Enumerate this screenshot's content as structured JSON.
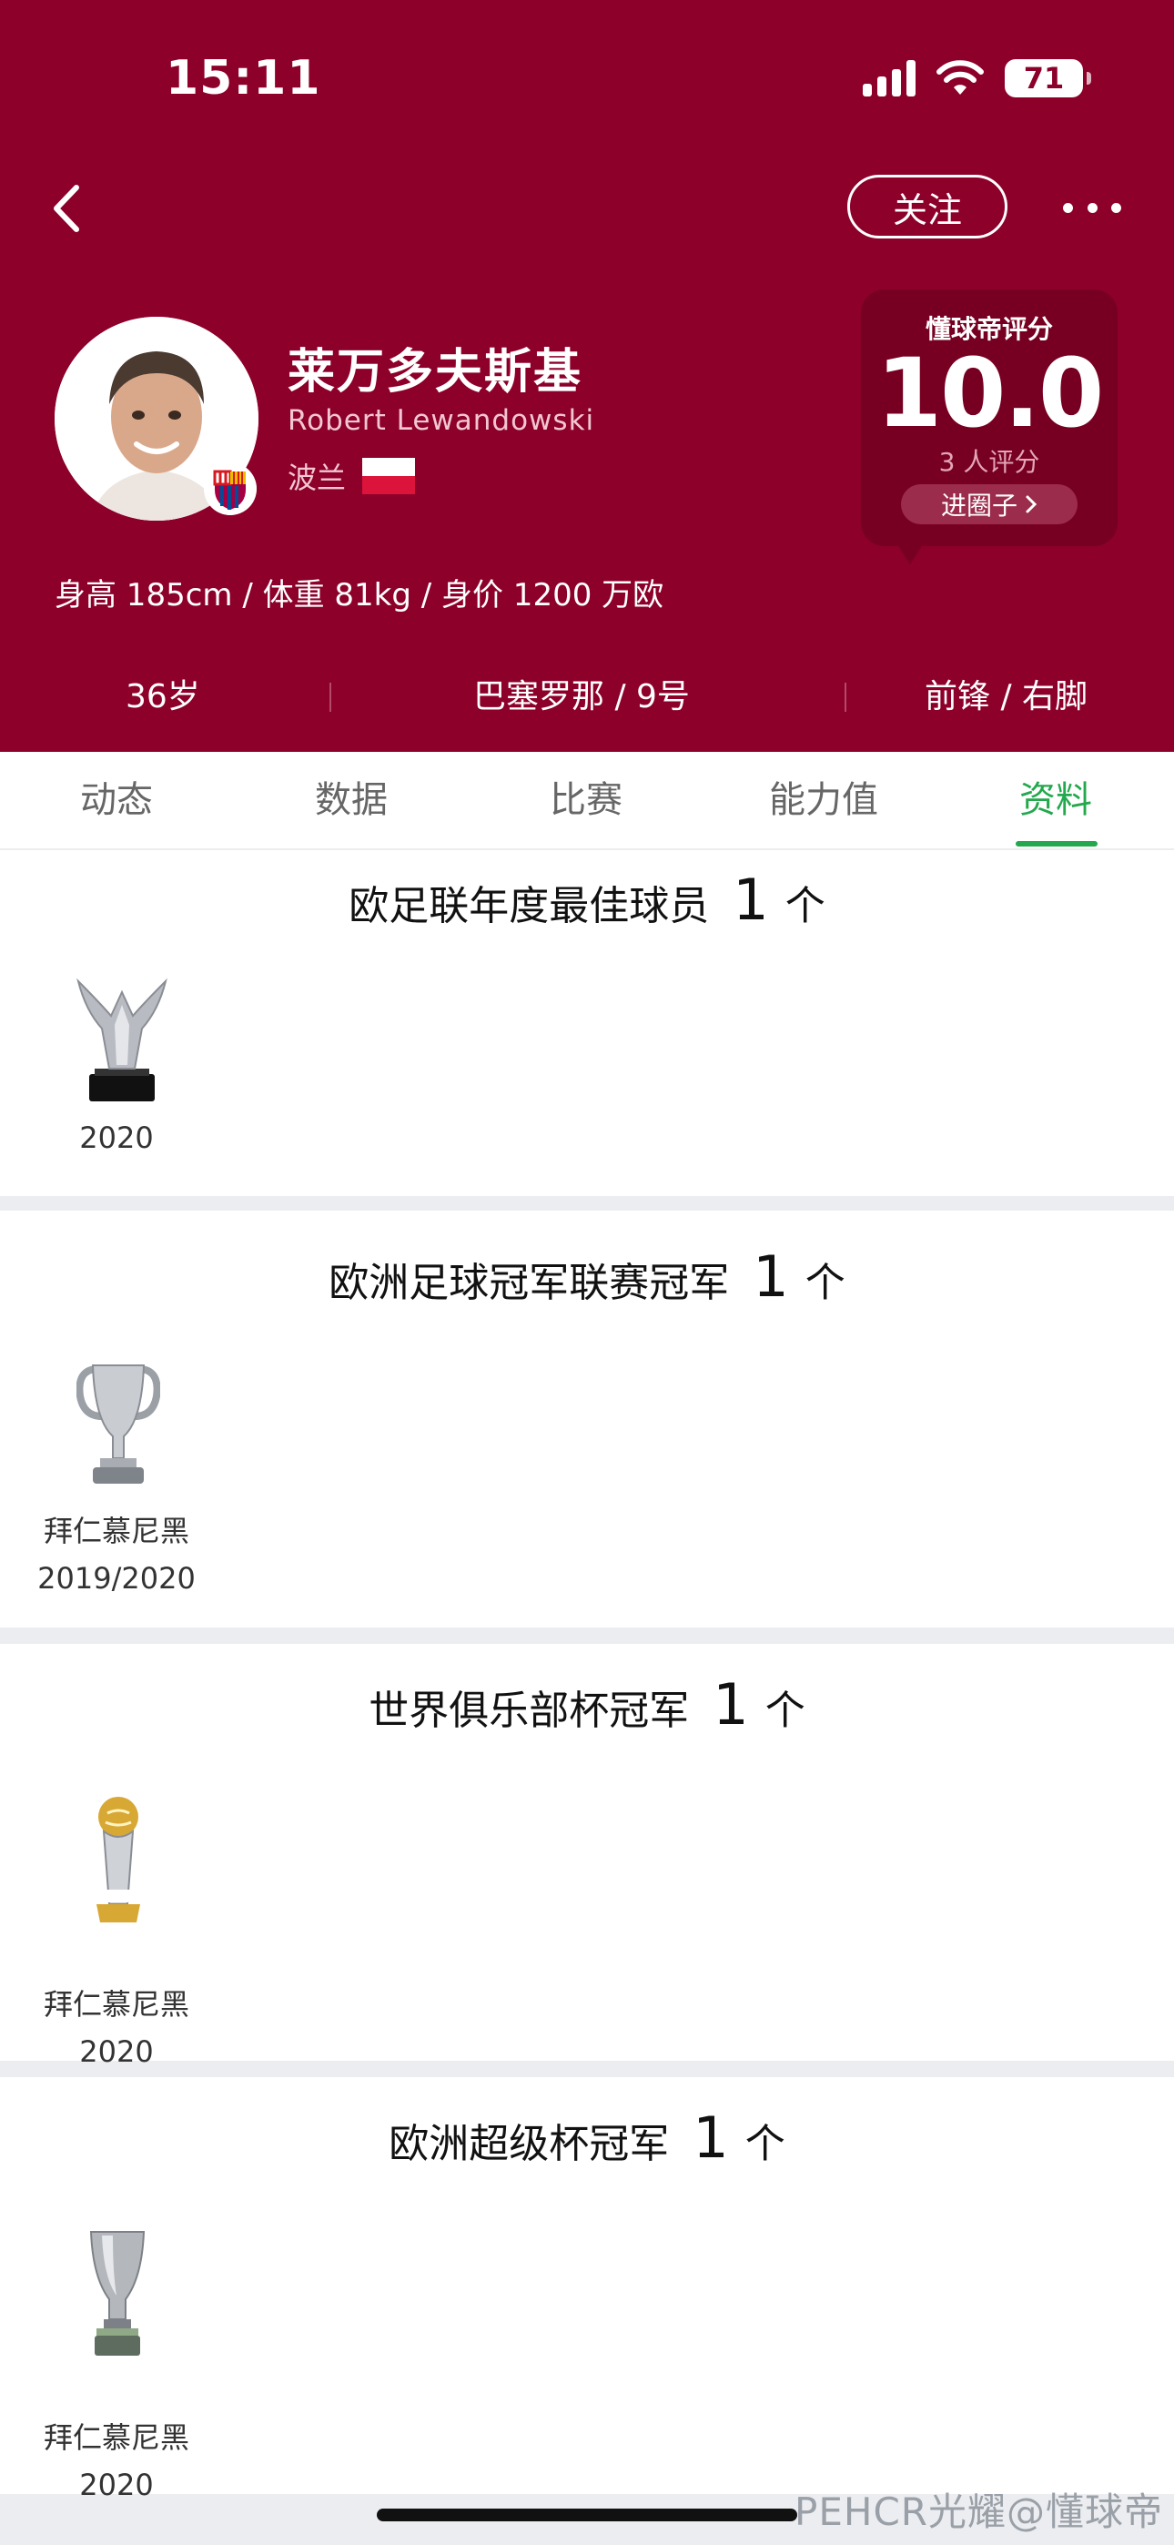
{
  "status_bar": {
    "time": "15:11",
    "battery": "71"
  },
  "header": {
    "follow_label": "关注",
    "player": {
      "name_cn": "莱万多夫斯基",
      "name_en": "Robert Lewandowski",
      "nationality": "波兰",
      "body_info": "身高 185cm / 体重 81kg / 身价 1200 万欧"
    },
    "rating": {
      "title": "懂球帝评分",
      "value": "10.0",
      "count": "3 人评分",
      "circle_button": "进圈子"
    },
    "meta": [
      {
        "text": "36岁"
      },
      {
        "text": "巴塞罗那 / 9号"
      },
      {
        "text": "前锋 / 右脚"
      }
    ]
  },
  "tabs": [
    {
      "label": "动态"
    },
    {
      "label": "数据"
    },
    {
      "label": "比赛"
    },
    {
      "label": "能力值"
    },
    {
      "label": "资料",
      "active": true
    }
  ],
  "honours": [
    {
      "title": "欧足联年度最佳球员",
      "count": "1",
      "unit": "个",
      "trophies": [
        {
          "icon": "uefa-player-award-icon",
          "team": "",
          "season": "2020"
        }
      ]
    },
    {
      "title": "欧洲足球冠军联赛冠军",
      "count": "1",
      "unit": "个",
      "trophies": [
        {
          "icon": "champions-league-trophy-icon",
          "team": "拜仁慕尼黑",
          "season": "2019/2020"
        }
      ]
    },
    {
      "title": "世界俱乐部杯冠军",
      "count": "1",
      "unit": "个",
      "trophies": [
        {
          "icon": "club-world-cup-trophy-icon",
          "team": "拜仁慕尼黑",
          "season": "2020"
        }
      ]
    },
    {
      "title": "欧洲超级杯冠军",
      "count": "1",
      "unit": "个",
      "trophies": [
        {
          "icon": "super-cup-trophy-icon",
          "team": "拜仁慕尼黑",
          "season": "2020"
        }
      ]
    }
  ],
  "watermark": "PEHCR光耀@懂球帝",
  "colors": {
    "header_bg": "#8c002a",
    "rating_card_bg": "#770022",
    "tab_active": "#23a84d"
  }
}
